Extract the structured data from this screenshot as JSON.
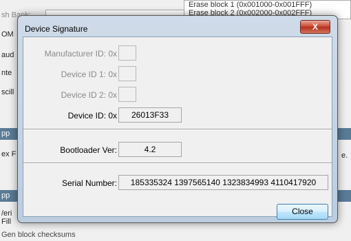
{
  "background": {
    "flash_bank_label": "sh Bank:",
    "erase_lines": [
      "Erase block 1 (0x001000-0x001FFF)",
      "Erase block 2 (0x002000-0x002FFF)"
    ],
    "left_labels": [
      "OM",
      "aud",
      "nte",
      "scill",
      "pp",
      "ex F",
      "pp",
      "/eri",
      "Fill"
    ],
    "right_fragment": "e.",
    "gen_block_checksums": "Gen block checksums"
  },
  "dialog": {
    "title": "Device Signature",
    "close_x_label": "X",
    "manufacturer_id": {
      "label": "Manufacturer ID: 0x",
      "value": ""
    },
    "device_id_1": {
      "label": "Device ID 1: 0x",
      "value": ""
    },
    "device_id_2": {
      "label": "Device ID 2: 0x",
      "value": ""
    },
    "device_id": {
      "label": "Device ID: 0x",
      "value": "26013F33"
    },
    "bootloader": {
      "label": "Bootloader Ver:",
      "value": "4.2"
    },
    "serial": {
      "label": "Serial Number:",
      "value": "185335324 1397565140 1323834993 4110417920"
    },
    "close_button_label": "Close"
  }
}
